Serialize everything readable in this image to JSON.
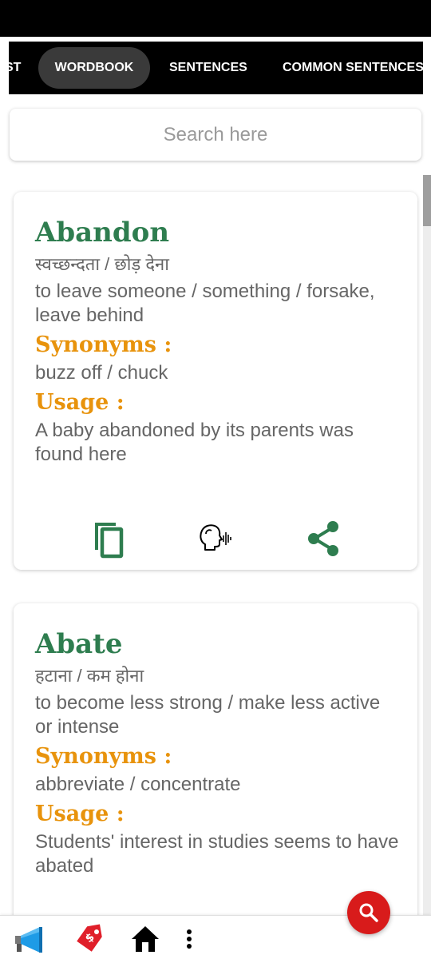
{
  "tabs": [
    {
      "label": "ST"
    },
    {
      "label": "WORDBOOK",
      "active": true
    },
    {
      "label": "SENTENCES"
    },
    {
      "label": "COMMON SENTENCES"
    }
  ],
  "search": {
    "placeholder": "Search here"
  },
  "cards": [
    {
      "word": "Abandon",
      "hindi": "स्वच्छन्दता / छोड़ देना",
      "meaning": "to leave someone / something / forsake, leave behind",
      "synonyms_title": "Synonyms :",
      "synonyms": "buzz off / chuck",
      "usage_title": "Usage :",
      "usage": "A baby abandoned by its parents was found here"
    },
    {
      "word": "Abate",
      "hindi": "हटाना / कम होना",
      "meaning": "to become less strong / make less active or intense",
      "synonyms_title": "Synonyms :",
      "synonyms": "abbreviate / concentrate",
      "usage_title": "Usage :",
      "usage": "Students' interest in studies seems to have abated"
    }
  ],
  "card_actions": [
    "copy-icon",
    "speak-icon",
    "share-icon"
  ],
  "bottom_nav": [
    "megaphone-icon",
    "price-tag-icon",
    "home-icon",
    "more-vert-icon"
  ],
  "colors": {
    "word": "#2e7d4f",
    "section_title": "#e8930c",
    "action_icon": "#2e7d4f",
    "fab": "#d81b1b",
    "tabbar": "#000000",
    "active_tab": "#3a3a3a"
  }
}
